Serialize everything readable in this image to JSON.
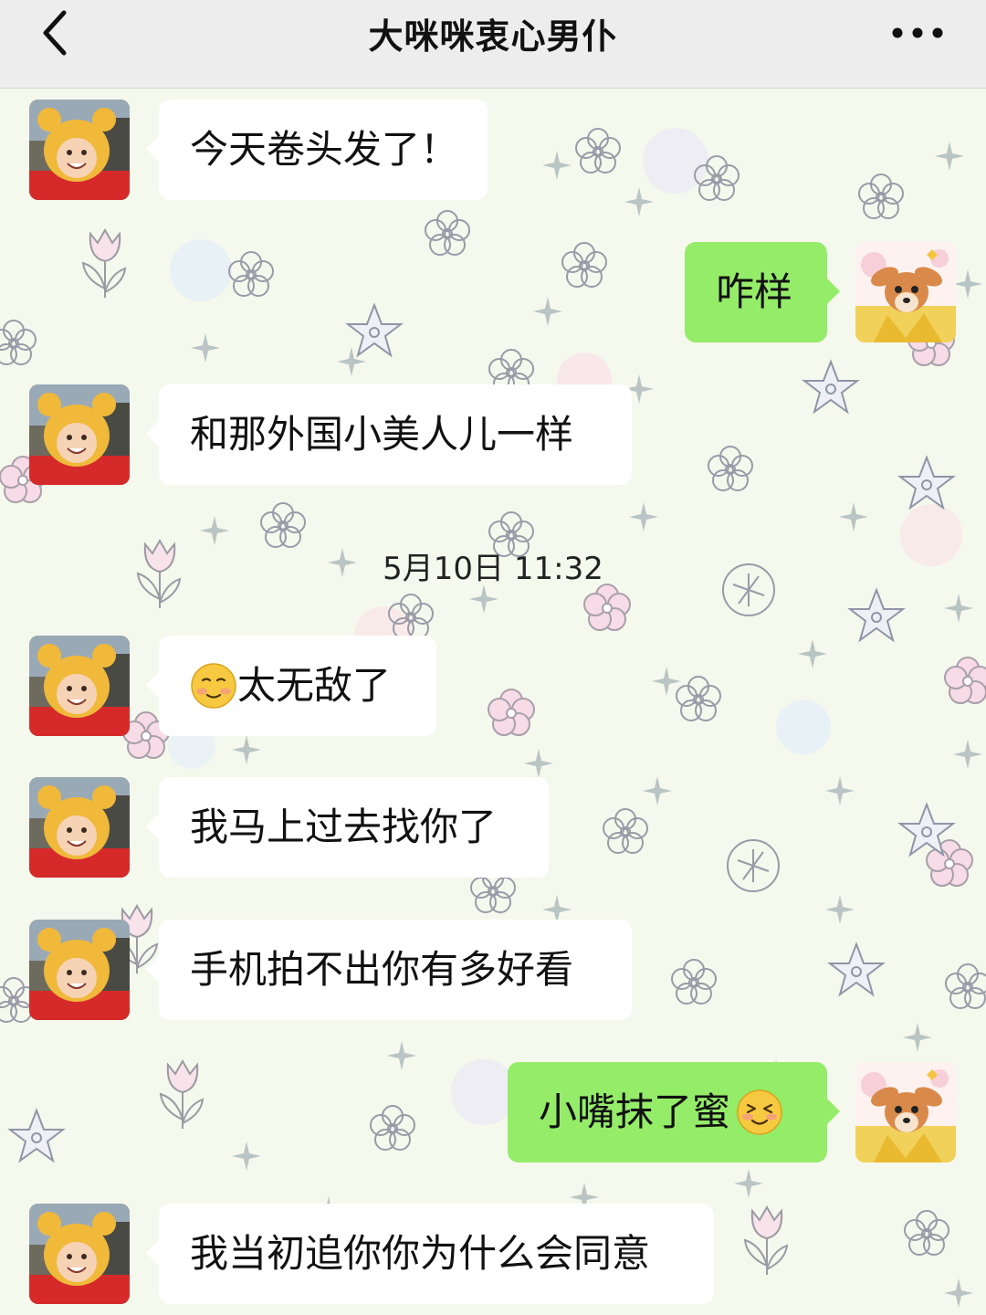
{
  "header": {
    "title": "大咪咪衷心男仆",
    "back_icon": "chevron-left-icon",
    "more_icon": "more-horizontal-icon",
    "background": "#ededed"
  },
  "colors": {
    "sent_bubble": "#95ec69",
    "received_bubble": "#ffffff",
    "wallpaper": "#f5f8ec"
  },
  "timestamp": "5月10日 11:32",
  "messages": [
    {
      "side": "left",
      "text": "今天卷头发了！",
      "avatar": "toddler-bear-hood-avatar"
    },
    {
      "side": "right",
      "text": "咋样",
      "avatar": "cartoon-deer-avatar"
    },
    {
      "side": "left",
      "text": "和那外国小美人儿一样",
      "avatar": "toddler-bear-hood-avatar"
    },
    {
      "side": "left",
      "text": "太无敌了",
      "emoji_before": "flushed-smile-emoji",
      "avatar": "toddler-bear-hood-avatar"
    },
    {
      "side": "left",
      "text": "我马上过去找你了",
      "avatar": "toddler-bear-hood-avatar"
    },
    {
      "side": "left",
      "text": "手机拍不出你有多好看",
      "avatar": "toddler-bear-hood-avatar"
    },
    {
      "side": "right",
      "text": "小嘴抹了蜜",
      "emoji_after": "shy-blush-emoji",
      "avatar": "cartoon-deer-avatar"
    },
    {
      "side": "left",
      "text": "我当初追你你为什么会同意",
      "avatar": "toddler-bear-hood-avatar"
    }
  ]
}
